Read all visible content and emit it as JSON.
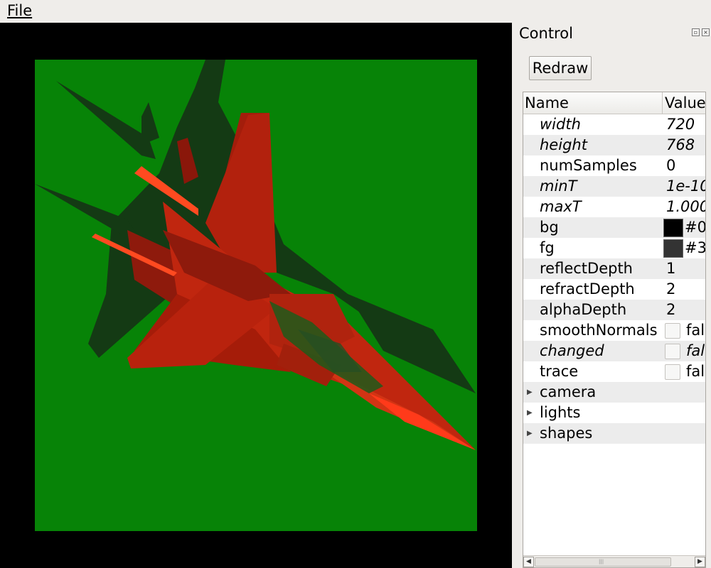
{
  "menubar": {
    "file": "File"
  },
  "panel": {
    "title": "Control",
    "redraw_label": "Redraw",
    "columns": {
      "name": "Name",
      "value": "Value"
    },
    "rows": [
      {
        "name": "width",
        "value": "720",
        "italic": true
      },
      {
        "name": "height",
        "value": "768",
        "italic": true
      },
      {
        "name": "numSamples",
        "value": "0",
        "italic": false
      },
      {
        "name": "minT",
        "value": "1e-10",
        "italic": true
      },
      {
        "name": "maxT",
        "value": "1.000",
        "italic": true
      },
      {
        "name": "bg",
        "color_text": "#0",
        "swatch": "#000000",
        "italic": false
      },
      {
        "name": "fg",
        "color_text": "#3",
        "swatch": "#333333",
        "italic": false
      },
      {
        "name": "reflectDepth",
        "value": "1",
        "italic": false
      },
      {
        "name": "refractDepth",
        "value": "2",
        "italic": false
      },
      {
        "name": "alphaDepth",
        "value": "2",
        "italic": false
      },
      {
        "name": "smoothNormals",
        "check_text": "fal",
        "italic": false
      },
      {
        "name": "changed",
        "check_text": "fal",
        "italic": true
      },
      {
        "name": "trace",
        "check_text": "fal",
        "italic": false
      },
      {
        "name": "camera",
        "group": true
      },
      {
        "name": "lights",
        "group": true
      },
      {
        "name": "shapes",
        "group": true
      }
    ]
  },
  "colors": {
    "render_bg": "#078307",
    "jet": "#b8200c",
    "shadow": "#143a14"
  }
}
